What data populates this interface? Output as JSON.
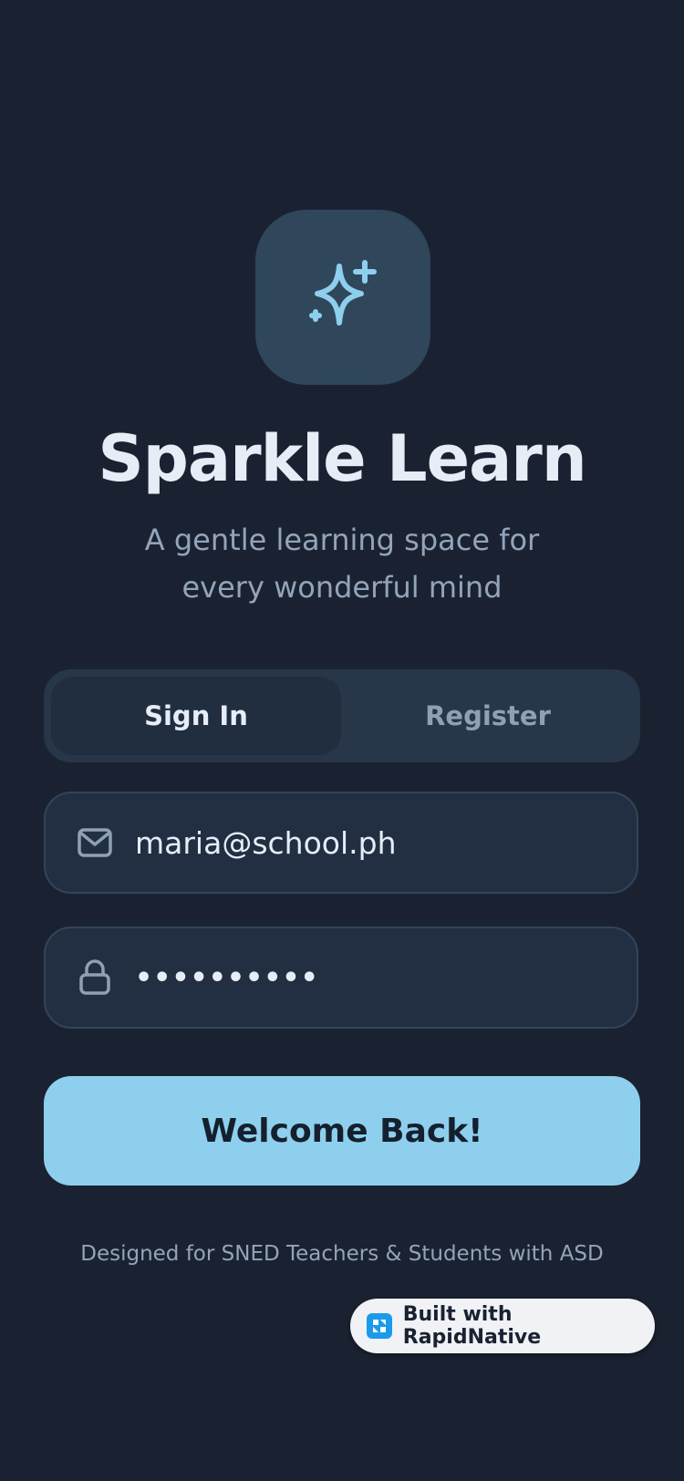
{
  "app": {
    "title": "Sparkle Learn",
    "subtitle": "A gentle learning space for every wonderful mind",
    "icon": "sparkle-icon"
  },
  "tabs": {
    "active": "Sign In",
    "items": [
      {
        "label": "Sign In",
        "active": true
      },
      {
        "label": "Register",
        "active": false
      }
    ]
  },
  "form": {
    "email": {
      "icon": "mail-icon",
      "value": "maria@school.ph"
    },
    "password": {
      "icon": "lock-icon",
      "masked_value": "••••••••••"
    },
    "submit_label": "Welcome Back!"
  },
  "footer": {
    "text": "Designed for SNED Teachers & Students with ASD"
  },
  "badge": {
    "label": "Built with RapidNative",
    "icon": "rapidnative-logo-icon"
  },
  "colors": {
    "background": "#1a2231",
    "accent": "#8ecfee",
    "icon_tile": "#2f465b",
    "text_primary": "#e6edf7",
    "text_muted": "#93a4ba"
  }
}
